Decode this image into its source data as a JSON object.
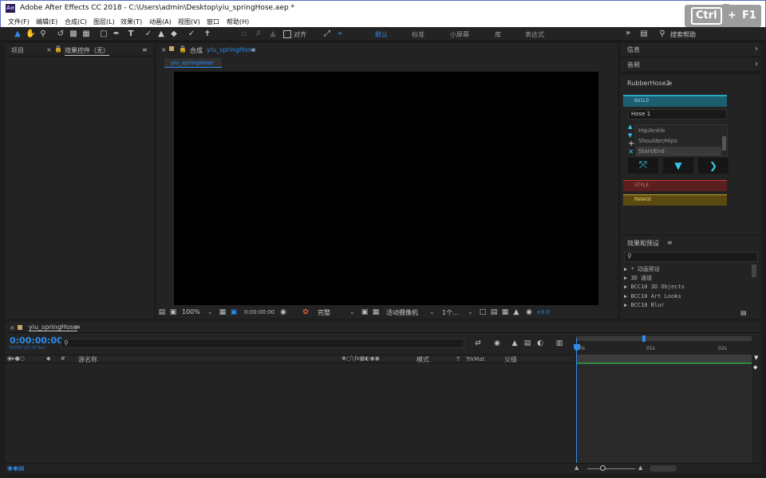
{
  "window": {
    "title": "Adobe After Effects CC 2018 - C:\\Users\\admin\\Desktop\\yiu_springHose.aep *",
    "app_icon": "Ae",
    "minimize": "–",
    "maximize": "□",
    "close": "×"
  },
  "menu": [
    "文件(F)",
    "编辑(E)",
    "合成(C)",
    "图层(L)",
    "效果(T)",
    "动画(A)",
    "视图(V)",
    "窗口",
    "帮助(H)"
  ],
  "overlay": {
    "key1": "Ctrl",
    "plus": "+",
    "key2": "F1"
  },
  "toolbar": {
    "snap_label": "对齐",
    "workspaces": [
      "默认",
      "标准",
      "小屏幕",
      "库",
      "表达式"
    ],
    "active_workspace": "默认",
    "more": "»",
    "search_help": "搜索帮助"
  },
  "left_panel": {
    "tab_project": "项目",
    "tab_effects": "效果控件（无）",
    "close": "×",
    "menu": "≡"
  },
  "comp_panel": {
    "tab_prefix": "合成",
    "comp_name": "yiu_springHose",
    "sub_tab": "yiu_springHose",
    "close": "×",
    "menu": "≡"
  },
  "viewer_bar": {
    "zoom": "100%",
    "timecode": "0:00:00:00",
    "resolution": "完整",
    "camera": "活动摄像机",
    "views": "1个...",
    "exposure": "+0.0"
  },
  "right_panel": {
    "info": "信息",
    "audio": "音频",
    "plugin_title": "RubberHose2",
    "build_label": "BUILD",
    "hose_name": "Hose 1",
    "hose_rows": [
      "Hip/Ankle",
      "Shoulder/Hips",
      "Start/End"
    ],
    "style_label": "STYLE",
    "manage_label": "MANAGE",
    "ep_title": "效果和预设",
    "ep_search_icon": "search-icon",
    "ep_items": [
      "* 动画预设",
      "3D 通道",
      "BCC10 3D Objects",
      "BCC10 Art Looks",
      "BCC10 Blur"
    ],
    "menu": "≡"
  },
  "timeline": {
    "comp_tab": "yiu_springHose",
    "close": "×",
    "menu": "≡",
    "timecode": "0:00:00:00",
    "timecode_sub": "00000 (25.00 fps)",
    "col_source": "源名称",
    "col_mode": "模式",
    "col_t": "T",
    "col_trkmat": "TrkMat",
    "col_parent": "父级",
    "ruler": [
      "0s",
      "01s",
      "02s"
    ]
  },
  "colors": {
    "accent": "#2d8ceb",
    "build": "#2aa9c6",
    "style": "#c0392b",
    "manage": "#c9a227",
    "cyan_icon": "#36c5f0"
  }
}
